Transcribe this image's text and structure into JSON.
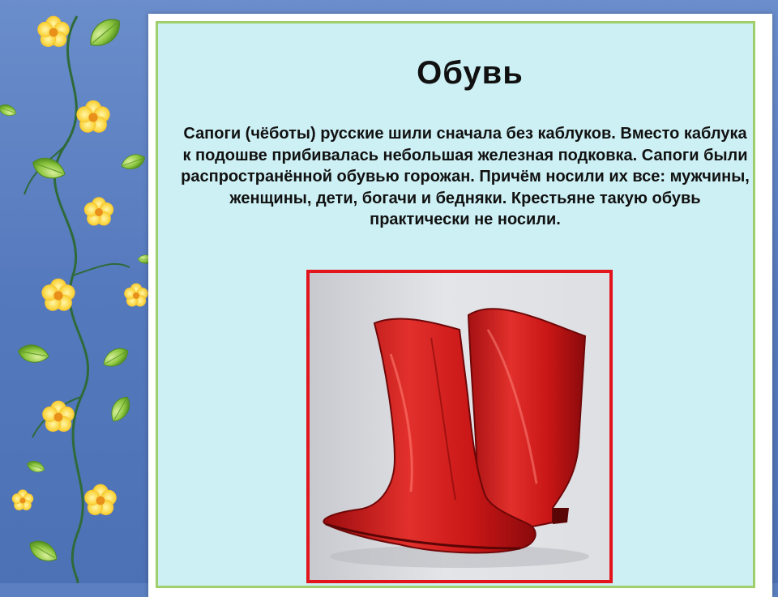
{
  "slide": {
    "title": "Обувь",
    "text": "Сапоги (чёботы) русские шили сначала без каблуков. Вместо каблука к подошве прибивалась небольшая железная подковка. Сапоги были распространённой обувью горожан. Причём носили их все: мужчины, женщины, дети, богачи и бедняки. Крестьяне такую обувь практически не носили."
  },
  "colors": {
    "background": "#5b7fc0",
    "panel": "#cdf0f4",
    "panel_border": "#9fcf6a",
    "photo_border": "#e3141c",
    "boot": "#d01818"
  },
  "decor": {
    "vine_icon": "flower-vine-icon",
    "photo_icon": "red-boots-photo"
  }
}
